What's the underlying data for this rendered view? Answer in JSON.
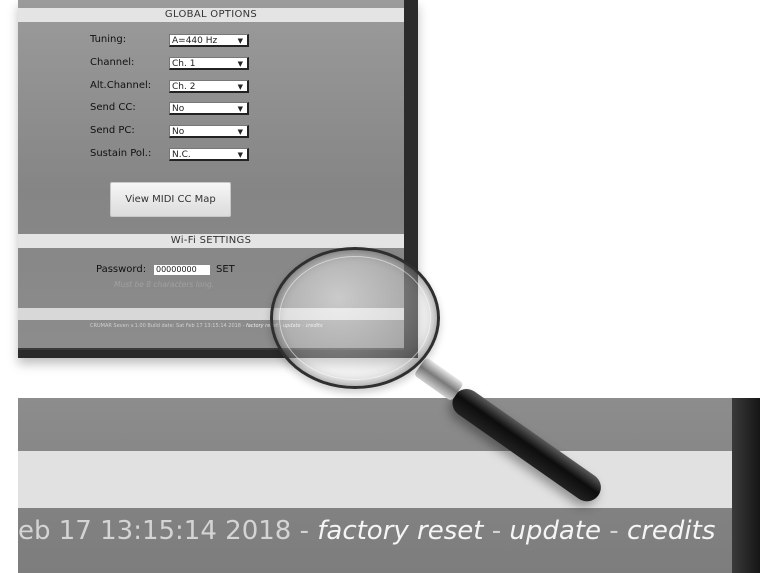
{
  "global_options": {
    "header": "GLOBAL OPTIONS",
    "rows": [
      {
        "label": "Tuning:",
        "value": "A=440 Hz"
      },
      {
        "label": "Channel:",
        "value": "Ch. 1"
      },
      {
        "label": "Alt.Channel:",
        "value": "Ch. 2"
      },
      {
        "label": "Send CC:",
        "value": "No"
      },
      {
        "label": "Send PC:",
        "value": "No"
      },
      {
        "label": "Sustain Pol.:",
        "value": "N.C."
      }
    ],
    "map_button": "View MIDI CC Map"
  },
  "wifi": {
    "header": "Wi-Fi SETTINGS",
    "password_label": "Password:",
    "password_value": "00000000",
    "set_label": "SET",
    "hint": "Must be 8 characters long."
  },
  "footer": {
    "build_text": "CRUMAR Seven v.1.00 Build date: Sat Feb 17 13:15:14 2018 - ",
    "sep": " - ",
    "factory_reset": "factory reset",
    "update": "update",
    "credits": "credits"
  },
  "zoomed_footer": {
    "build_text": "eb 17 13:15:14 2018 - ",
    "sep": " - ",
    "factory_reset": "factory reset",
    "update": "update",
    "credits": "credits"
  }
}
